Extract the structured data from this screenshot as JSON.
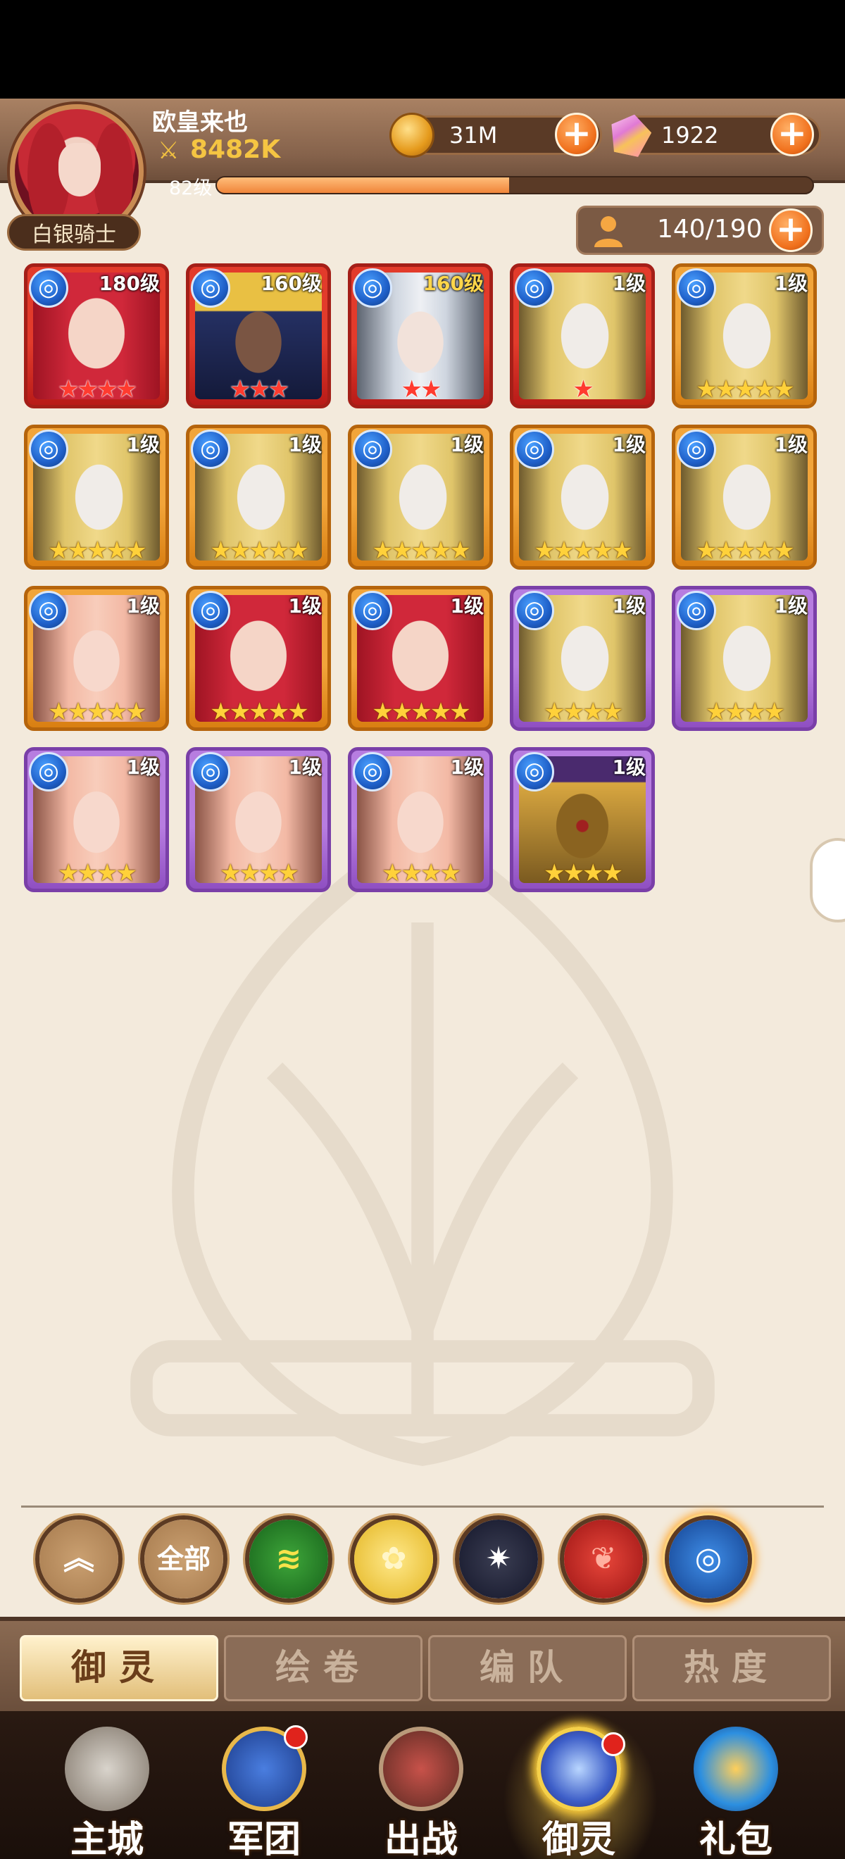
{
  "player": {
    "name": "欧皇来也",
    "power": "8482K",
    "rank": "白银骑士",
    "level": "82级",
    "xp_progress": 0.49
  },
  "resources": {
    "gold": "31M",
    "gems": "1922",
    "capacity": "140/190"
  },
  "heroes": [
    {
      "level": "180级",
      "stars": 4,
      "star_color": "red",
      "frame": "red",
      "portrait": "red-hair",
      "level_highlight": false
    },
    {
      "level": "160级",
      "stars": 3,
      "star_color": "red",
      "frame": "red",
      "portrait": "dark-skin",
      "level_highlight": false
    },
    {
      "level": "160级",
      "stars": 2,
      "star_color": "red",
      "frame": "red",
      "portrait": "silver-hair",
      "level_highlight": true
    },
    {
      "level": "1级",
      "stars": 1,
      "star_color": "red",
      "frame": "red",
      "portrait": "blonde",
      "level_highlight": false
    },
    {
      "level": "1级",
      "stars": 5,
      "star_color": "yellow",
      "frame": "orange",
      "portrait": "blonde",
      "level_highlight": false
    },
    {
      "level": "1级",
      "stars": 5,
      "star_color": "yellow",
      "frame": "orange",
      "portrait": "blonde",
      "level_highlight": false
    },
    {
      "level": "1级",
      "stars": 5,
      "star_color": "yellow",
      "frame": "orange",
      "portrait": "blonde",
      "level_highlight": false
    },
    {
      "level": "1级",
      "stars": 5,
      "star_color": "yellow",
      "frame": "orange",
      "portrait": "blonde",
      "level_highlight": false
    },
    {
      "level": "1级",
      "stars": 5,
      "star_color": "yellow",
      "frame": "orange",
      "portrait": "blonde",
      "level_highlight": false
    },
    {
      "level": "1级",
      "stars": 5,
      "star_color": "yellow",
      "frame": "orange",
      "portrait": "blonde",
      "level_highlight": false
    },
    {
      "level": "1级",
      "stars": 5,
      "star_color": "yellow",
      "frame": "orange",
      "portrait": "pink-hair",
      "level_highlight": false
    },
    {
      "level": "1级",
      "stars": 5,
      "star_color": "yellow",
      "frame": "orange",
      "portrait": "red-hair",
      "level_highlight": false
    },
    {
      "level": "1级",
      "stars": 5,
      "star_color": "yellow",
      "frame": "orange",
      "portrait": "red-hair",
      "level_highlight": false
    },
    {
      "level": "1级",
      "stars": 4,
      "star_color": "yellow",
      "frame": "purple",
      "portrait": "blonde",
      "level_highlight": false
    },
    {
      "level": "1级",
      "stars": 4,
      "star_color": "yellow",
      "frame": "purple",
      "portrait": "blonde",
      "level_highlight": false
    },
    {
      "level": "1级",
      "stars": 4,
      "star_color": "yellow",
      "frame": "purple",
      "portrait": "pink-hair",
      "level_highlight": false
    },
    {
      "level": "1级",
      "stars": 4,
      "star_color": "yellow",
      "frame": "purple",
      "portrait": "pink-hair",
      "level_highlight": false
    },
    {
      "level": "1级",
      "stars": 4,
      "star_color": "yellow",
      "frame": "purple",
      "portrait": "pink-hair",
      "level_highlight": false
    },
    {
      "level": "1级",
      "stars": 4,
      "star_color": "yellow",
      "frame": "purple",
      "portrait": "golden-mask",
      "level_highlight": false
    }
  ],
  "filters": [
    {
      "icon": "collapse-up-icon",
      "label": ""
    },
    {
      "icon": "all-icon",
      "label": "全部"
    },
    {
      "icon": "wind-element-icon",
      "label": ""
    },
    {
      "icon": "light-element-icon",
      "label": ""
    },
    {
      "icon": "dark-element-icon",
      "label": ""
    },
    {
      "icon": "fire-element-icon",
      "label": ""
    },
    {
      "icon": "water-element-icon",
      "label": ""
    }
  ],
  "tabs": [
    {
      "label": "御灵",
      "active": true
    },
    {
      "label": "绘卷",
      "active": false
    },
    {
      "label": "编队",
      "active": false
    },
    {
      "label": "热度",
      "active": false
    }
  ],
  "nav": [
    {
      "label": "主城",
      "icon": "castle-icon",
      "dot": false,
      "active": false
    },
    {
      "label": "军团",
      "icon": "legion-fist-icon",
      "dot": true,
      "active": false
    },
    {
      "label": "出战",
      "icon": "battle-sword-icon",
      "dot": false,
      "active": false
    },
    {
      "label": "御灵",
      "icon": "spirit-crystal-icon",
      "dot": true,
      "active": true
    },
    {
      "label": "礼包",
      "icon": "gift-shop-icon",
      "dot": false,
      "active": false
    }
  ],
  "colors": {
    "frame_red": "#a41f18",
    "frame_orange": "#b5640c",
    "frame_purple": "#7a3fa8",
    "accent_orange": "#f0701c"
  }
}
